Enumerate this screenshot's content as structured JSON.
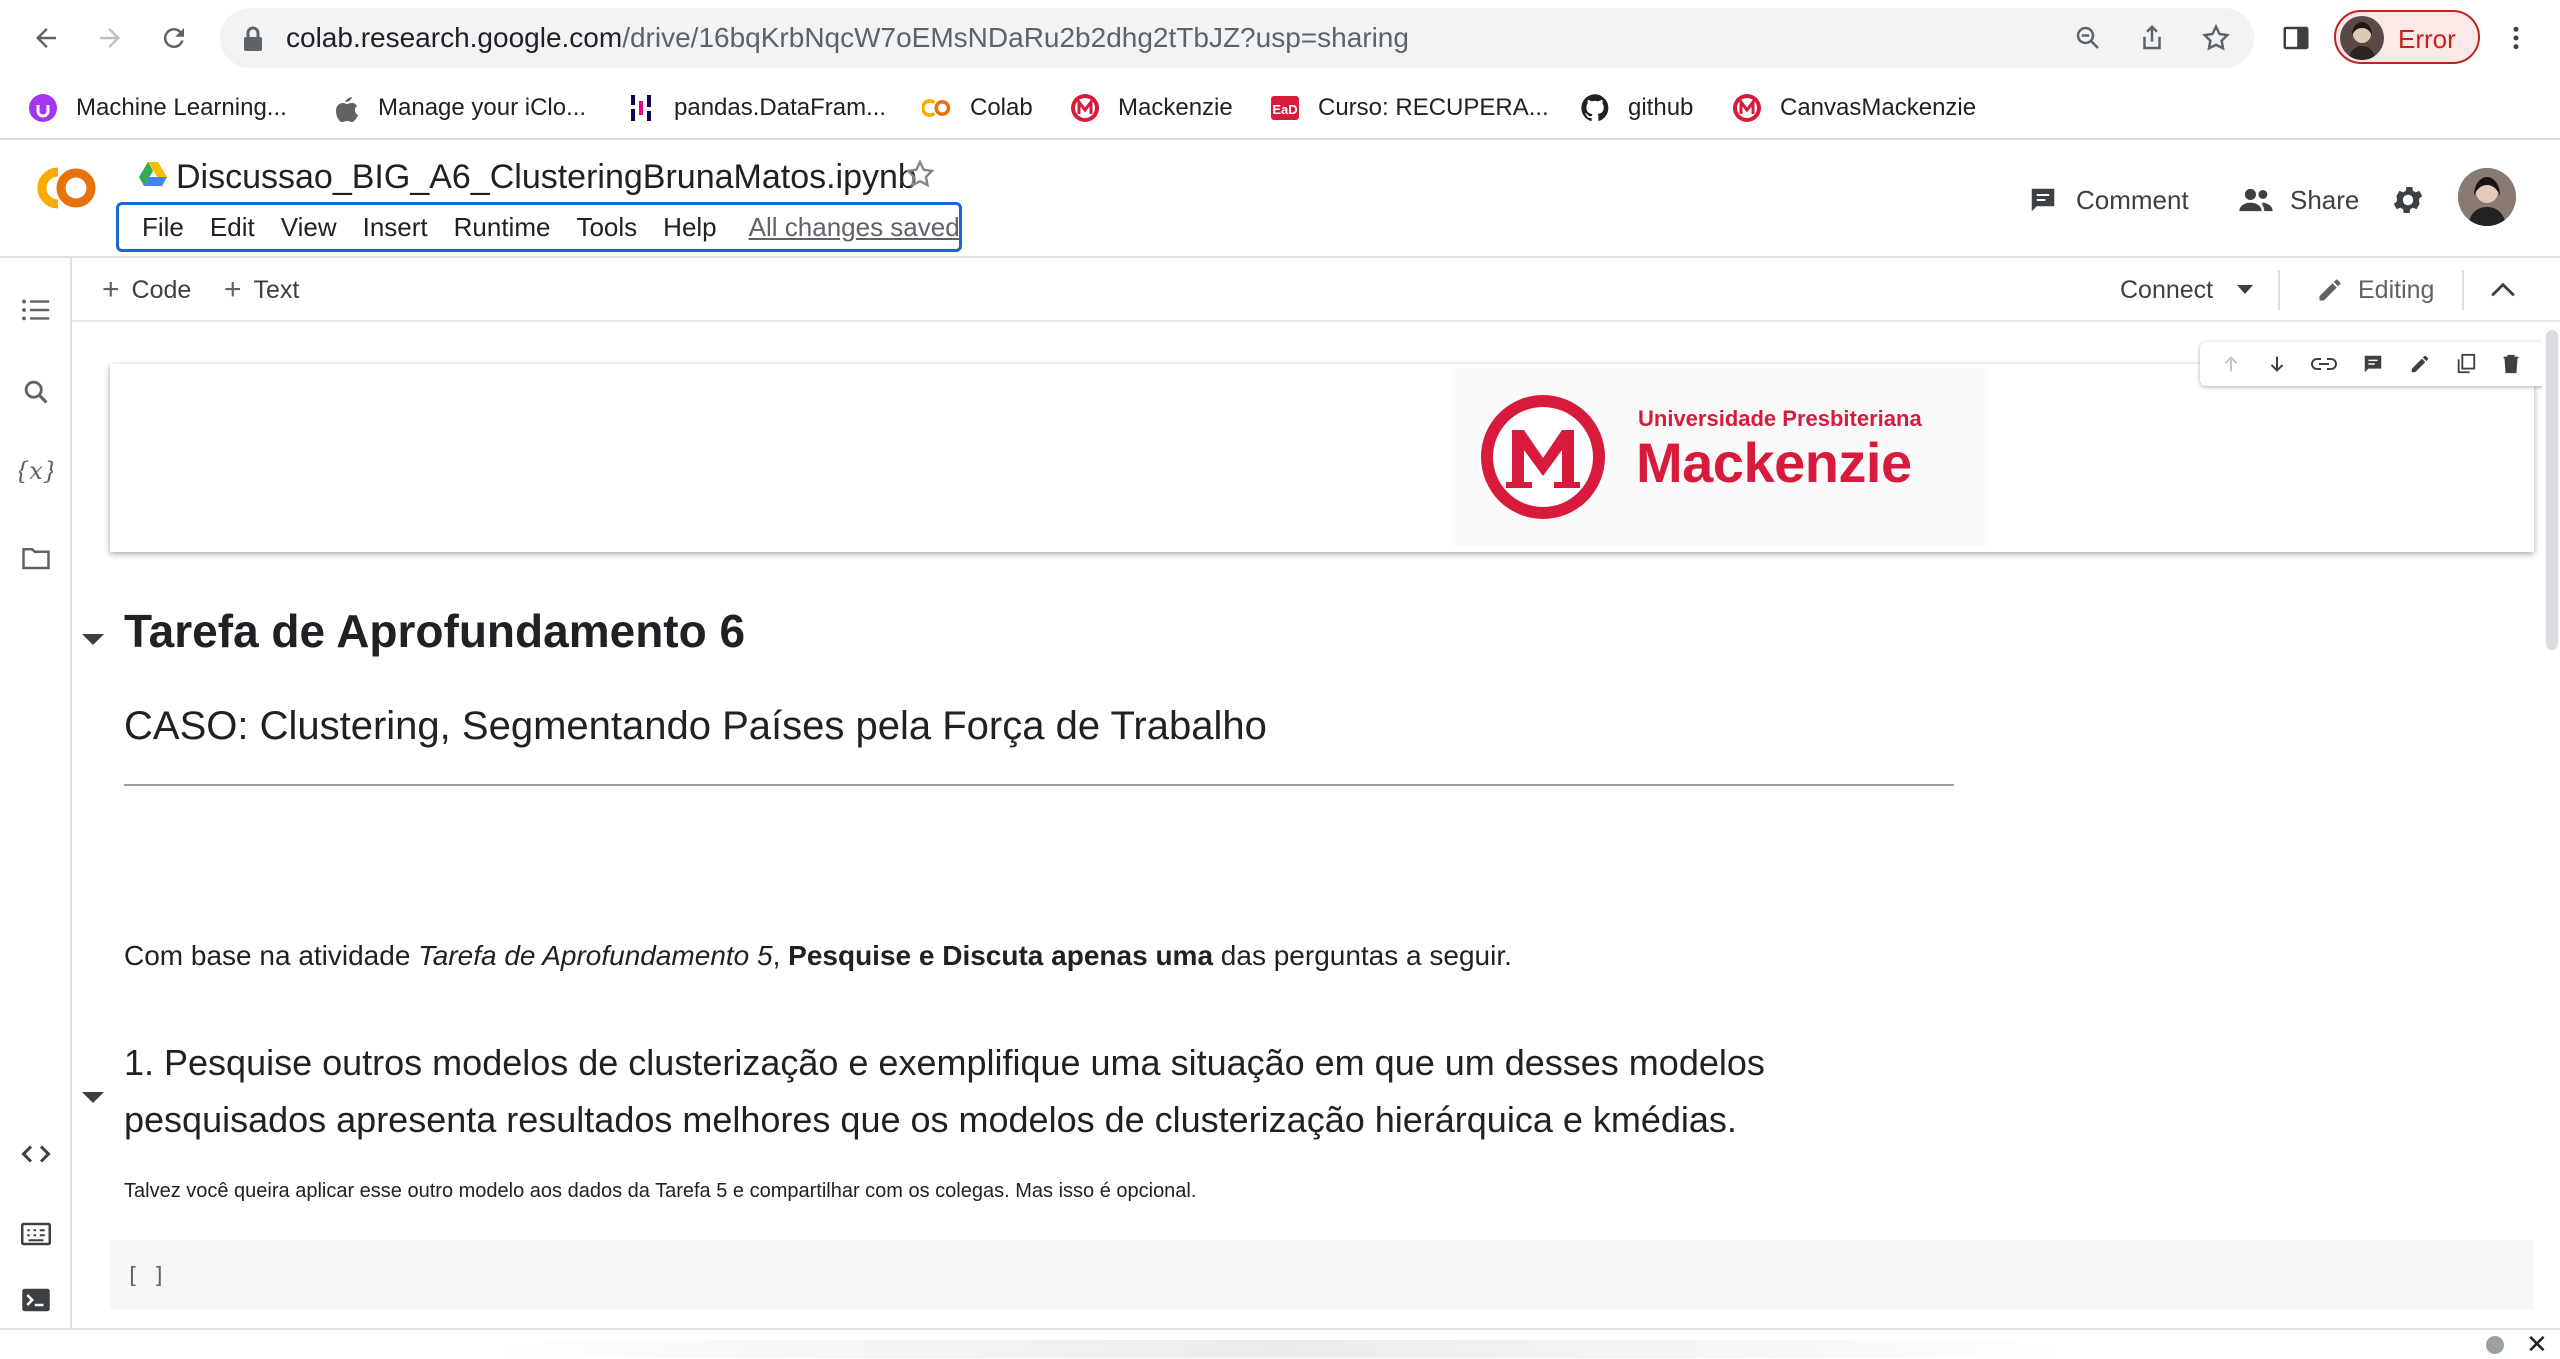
{
  "browser": {
    "url_host": "colab.research.google.com",
    "url_path": "/drive/16bqKrbNqcW7oEMsNDaRu2b2dhg2tTbJZ?usp=sharing",
    "profile_label": "Error",
    "bookmarks": [
      {
        "label": "Machine Learning...",
        "icon": "udemy-icon"
      },
      {
        "label": "Manage your iClo...",
        "icon": "apple-icon"
      },
      {
        "label": "pandas.DataFram...",
        "icon": "pandas-icon"
      },
      {
        "label": "Colab",
        "icon": "colab-icon"
      },
      {
        "label": "Mackenzie",
        "icon": "mackenzie-icon"
      },
      {
        "label": "Curso: RECUPERA...",
        "icon": "ead-icon"
      },
      {
        "label": "github",
        "icon": "github-icon"
      },
      {
        "label": "CanvasMackenzie",
        "icon": "mackenzie-icon"
      }
    ]
  },
  "colab": {
    "notebook_title": "Discussao_BIG_A6_ClusteringBrunaMatos.ipynb",
    "menu": [
      "File",
      "Edit",
      "View",
      "Insert",
      "Runtime",
      "Tools",
      "Help"
    ],
    "save_status": "All changes saved",
    "comment_label": "Comment",
    "share_label": "Share",
    "toolbar": {
      "add_code": "Code",
      "add_text": "Text",
      "connect": "Connect",
      "editing": "Editing"
    }
  },
  "notebook": {
    "logo": {
      "university_line": "Universidade Presbiteriana",
      "name": "Mackenzie"
    },
    "heading": "Tarefa de Aprofundamento 6",
    "subheading": "CASO: Clustering, Segmentando Países pela Força de Trabalho",
    "intro": {
      "part1": "Com base na atividade ",
      "italic": "Tarefa de Aprofundamento 5",
      "part2": ", ",
      "bold": "Pesquise e Discuta apenas uma",
      "part3": " das perguntas a seguir."
    },
    "question1": "1. Pesquise outros modelos de clusterização e exemplifique uma situação em que um desses modelos pesquisados apresenta resultados melhores que os modelos de clusterização hierárquica e kmédias.",
    "note": "Talvez você queira aplicar esse outro modelo aos dados da Tarefa 5 e compartilhar com os colegas. Mas isso é opcional.",
    "code_cell_prompt": "[ ]"
  },
  "colors": {
    "accent_blue": "#1967d2",
    "mackenzie_red": "#d81b3c",
    "colab_orange": "#f9ab00",
    "error_red": "#c5221f"
  }
}
